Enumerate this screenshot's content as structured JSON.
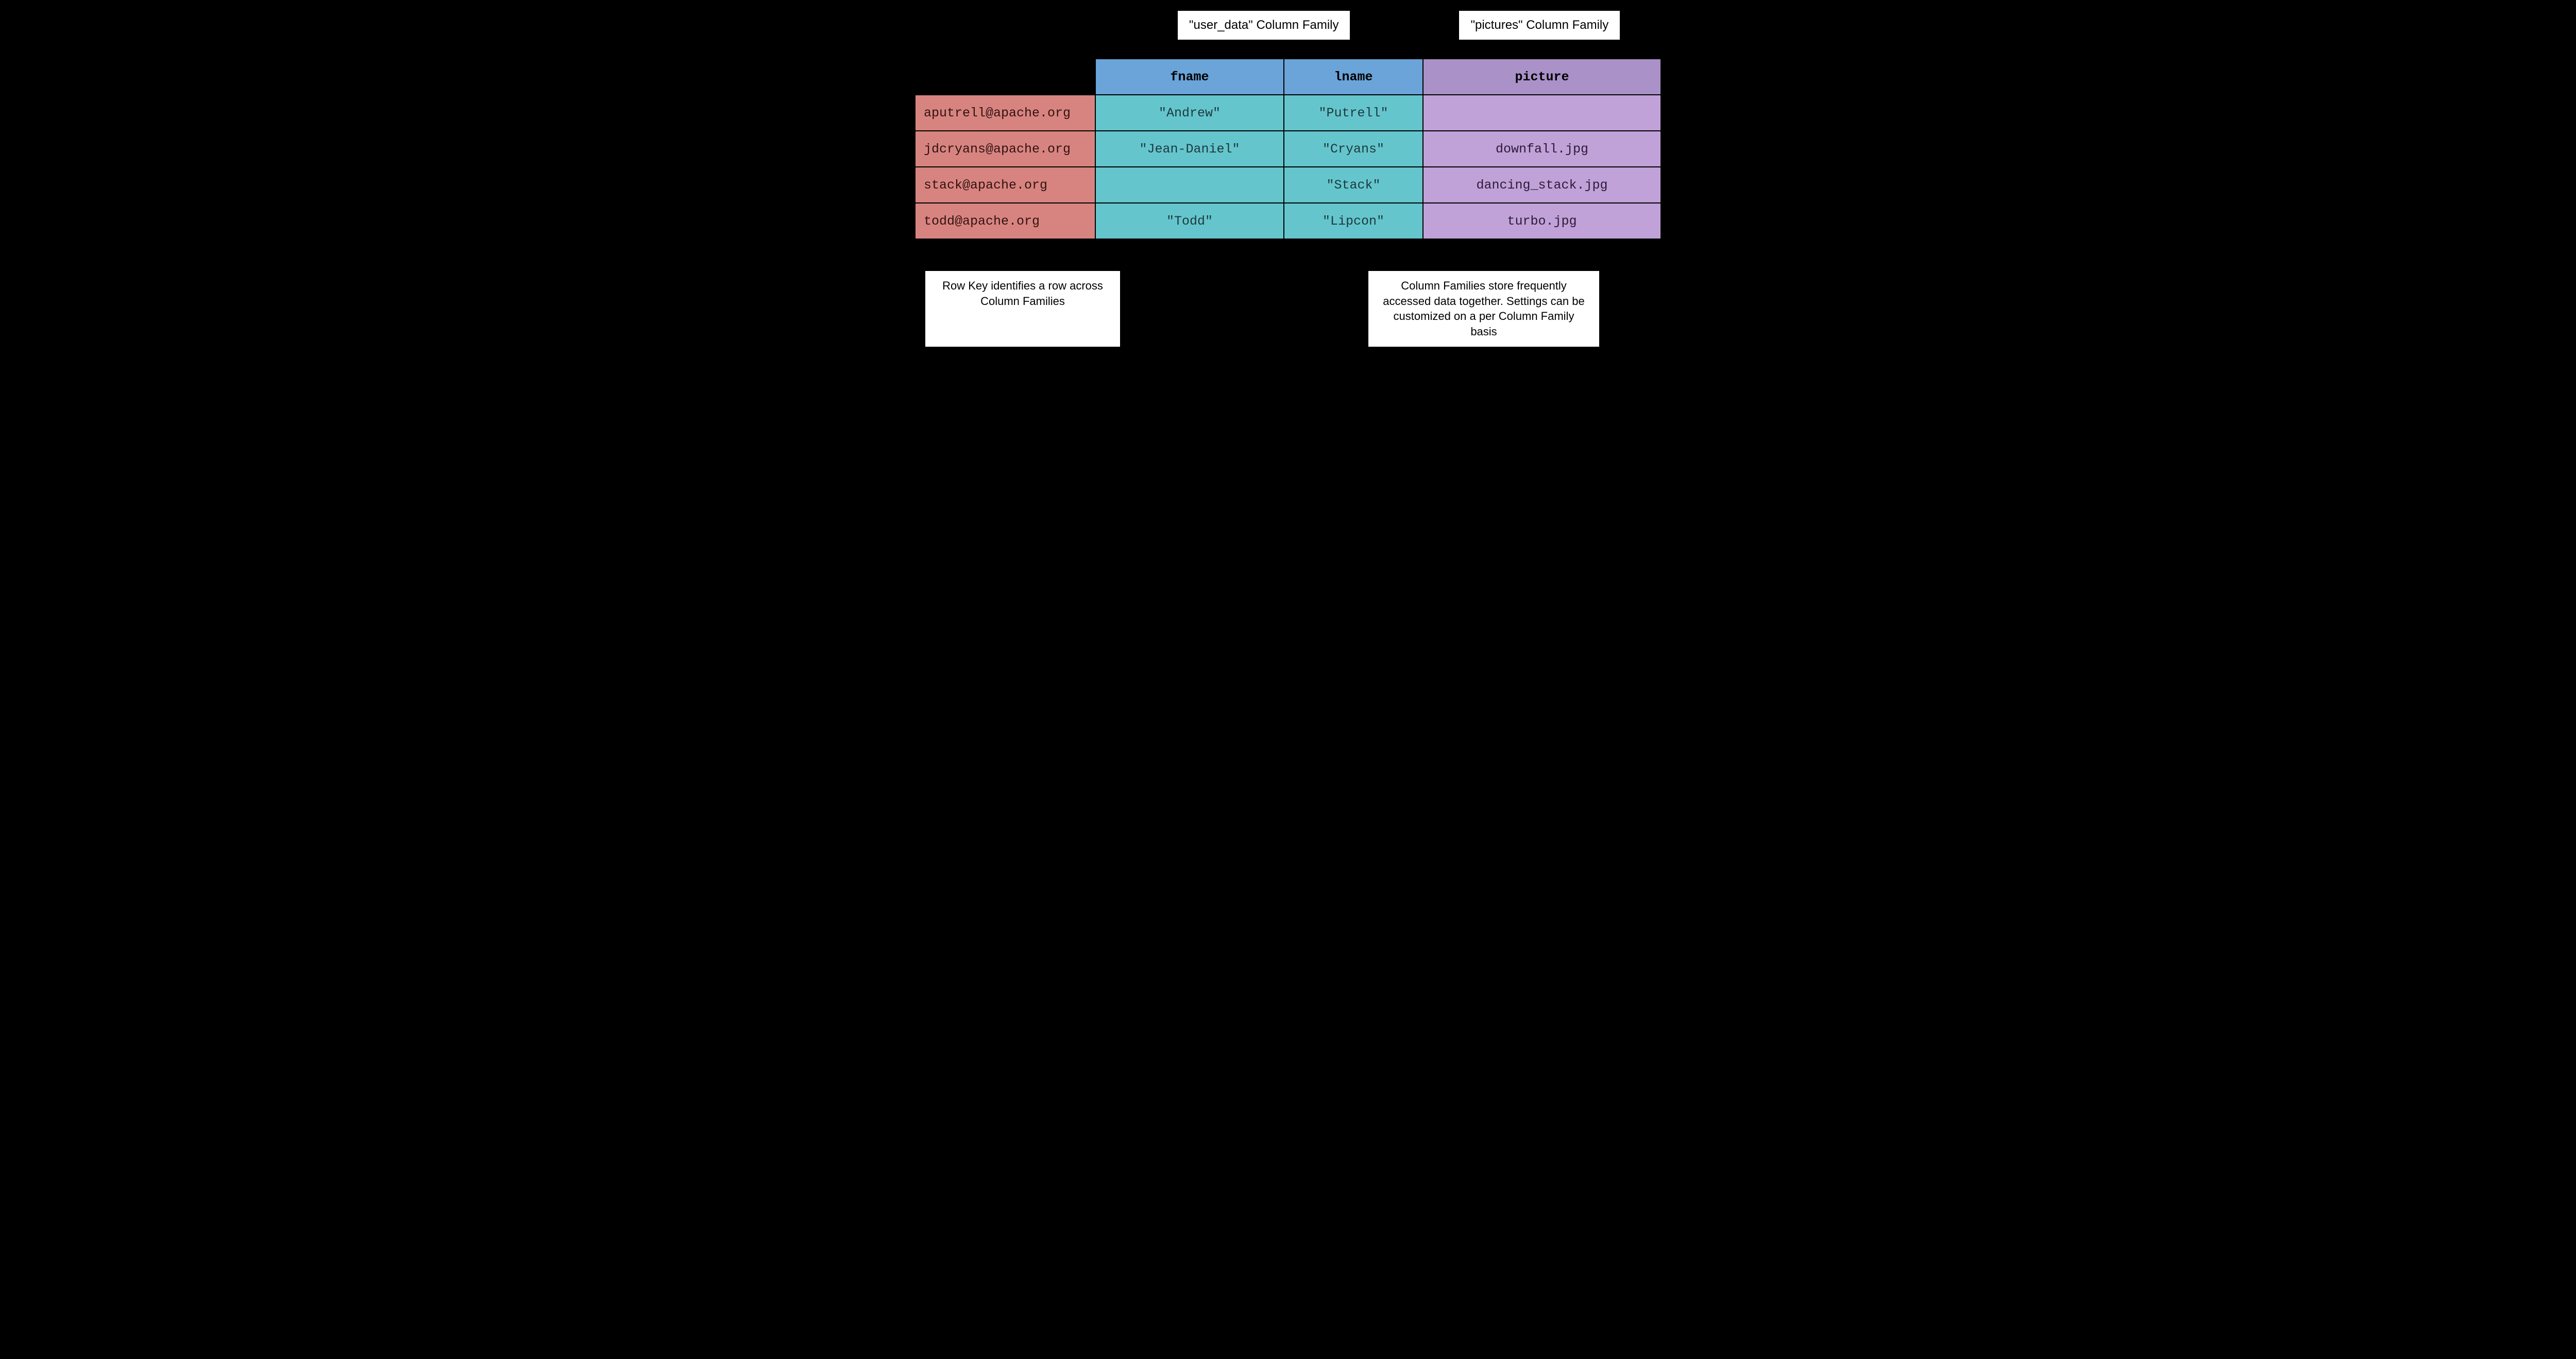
{
  "labels": {
    "userDataCF": "\"user_data\" Column Family",
    "picturesCF": "\"pictures\" Column Family",
    "rowKeyNote": "Row Key identifies a row across Column Families",
    "cfNote": "Column Families store frequently accessed data together. Settings can be customized on a per Column Family basis"
  },
  "headers": {
    "fname": "fname",
    "lname": "lname",
    "picture": "picture"
  },
  "rows": [
    {
      "key": "aputrell@apache.org",
      "fname": "\"Andrew\"",
      "lname": "\"Putrell\"",
      "picture": ""
    },
    {
      "key": "jdcryans@apache.org",
      "fname": "\"Jean-Daniel\"",
      "lname": "\"Cryans\"",
      "picture": "downfall.jpg"
    },
    {
      "key": "stack@apache.org",
      "fname": "",
      "lname": "\"Stack\"",
      "picture": "dancing_stack.jpg"
    },
    {
      "key": "todd@apache.org",
      "fname": "\"Todd\"",
      "lname": "\"Lipcon\"",
      "picture": "turbo.jpg"
    }
  ]
}
